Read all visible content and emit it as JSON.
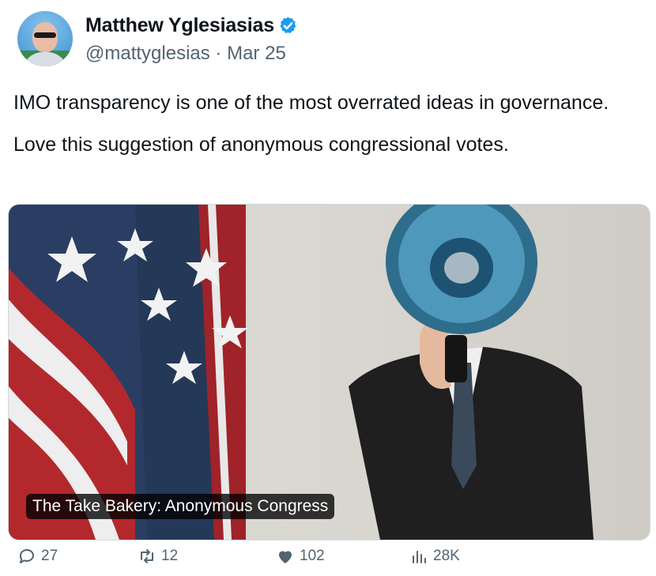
{
  "tweet": {
    "author_name": "Matthew Yglesiasias",
    "handle": "@mattyglesias",
    "separator": "·",
    "date": "Mar 25",
    "paragraphs": [
      "IMO transparency is one of the most overrated ideas in governance.",
      "Love this suggestion of anonymous congressional votes."
    ]
  },
  "media": {
    "caption": "The Take Bakery: Anonymous Congress"
  },
  "actions": {
    "replies": "27",
    "retweets": "12",
    "likes": "102",
    "views": "28K"
  },
  "colors": {
    "verified": "#1d9bf0",
    "muted": "#536471"
  },
  "icons": {
    "verified": "verified-badge-icon",
    "reply": "reply-icon",
    "retweet": "retweet-icon",
    "like": "heart-icon",
    "views": "views-chart-icon"
  }
}
